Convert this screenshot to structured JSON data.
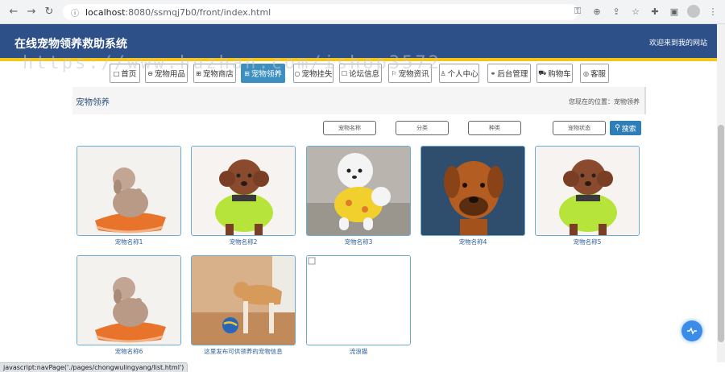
{
  "browser": {
    "url_host": "localhost",
    "url_path": ":8080/ssmqj7b0/front/index.html"
  },
  "header": {
    "title": "在线宠物领养救助系统",
    "welcome": "欢迎来到我的网站"
  },
  "watermark": "https://www.huzhan.com/ishop3572",
  "nav": [
    {
      "label": "首页",
      "icon": "square-icon",
      "glyph": "□"
    },
    {
      "label": "宠物用品",
      "icon": "circle-icon",
      "glyph": "⊖"
    },
    {
      "label": "宠物商店",
      "icon": "grid-icon",
      "glyph": "⊞"
    },
    {
      "label": "宠物领养",
      "icon": "grid-icon",
      "glyph": "⊞",
      "active": true
    },
    {
      "label": "宠物挂失",
      "icon": "circle-icon",
      "glyph": "○"
    },
    {
      "label": "论坛信息",
      "icon": "square-icon",
      "glyph": "☐"
    },
    {
      "label": "宠物资讯",
      "icon": "flag-icon",
      "glyph": "⚐"
    },
    {
      "label": "个人中心",
      "icon": "user-icon",
      "glyph": "♙"
    },
    {
      "label": "后台管理",
      "icon": "link-icon",
      "glyph": "⚭"
    },
    {
      "label": "购物车",
      "icon": "cart-icon",
      "glyph": "⛟"
    },
    {
      "label": "客服",
      "icon": "support-icon",
      "glyph": "◎"
    }
  ],
  "breadcrumb": {
    "title": "宠物领养",
    "location": "您现在的位置：宠物领养"
  },
  "search": {
    "fields": [
      "宠物名称",
      "分类",
      "种类",
      "宠物状态"
    ],
    "button_label": "搜索"
  },
  "cards": [
    {
      "name": "宠物名称1",
      "image": "poodle-on-mat"
    },
    {
      "name": "宠物名称2",
      "image": "poodle-in-green-jacket"
    },
    {
      "name": "宠物名称3",
      "image": "white-dog-in-yellow-shirt"
    },
    {
      "name": "宠物名称4",
      "image": "brown-mastiff"
    },
    {
      "name": "宠物名称5",
      "image": "poodle-in-green-jacket"
    },
    {
      "name": "宠物名称6",
      "image": "poodle-on-mat"
    },
    {
      "name": "这里发布可供领养的宠物信息",
      "image": "dog-with-ball"
    },
    {
      "name": "流浪猫",
      "image": "broken-image"
    }
  ],
  "status_bar": "javascript:navPage('./pages/chongwulingyang/list.html')"
}
